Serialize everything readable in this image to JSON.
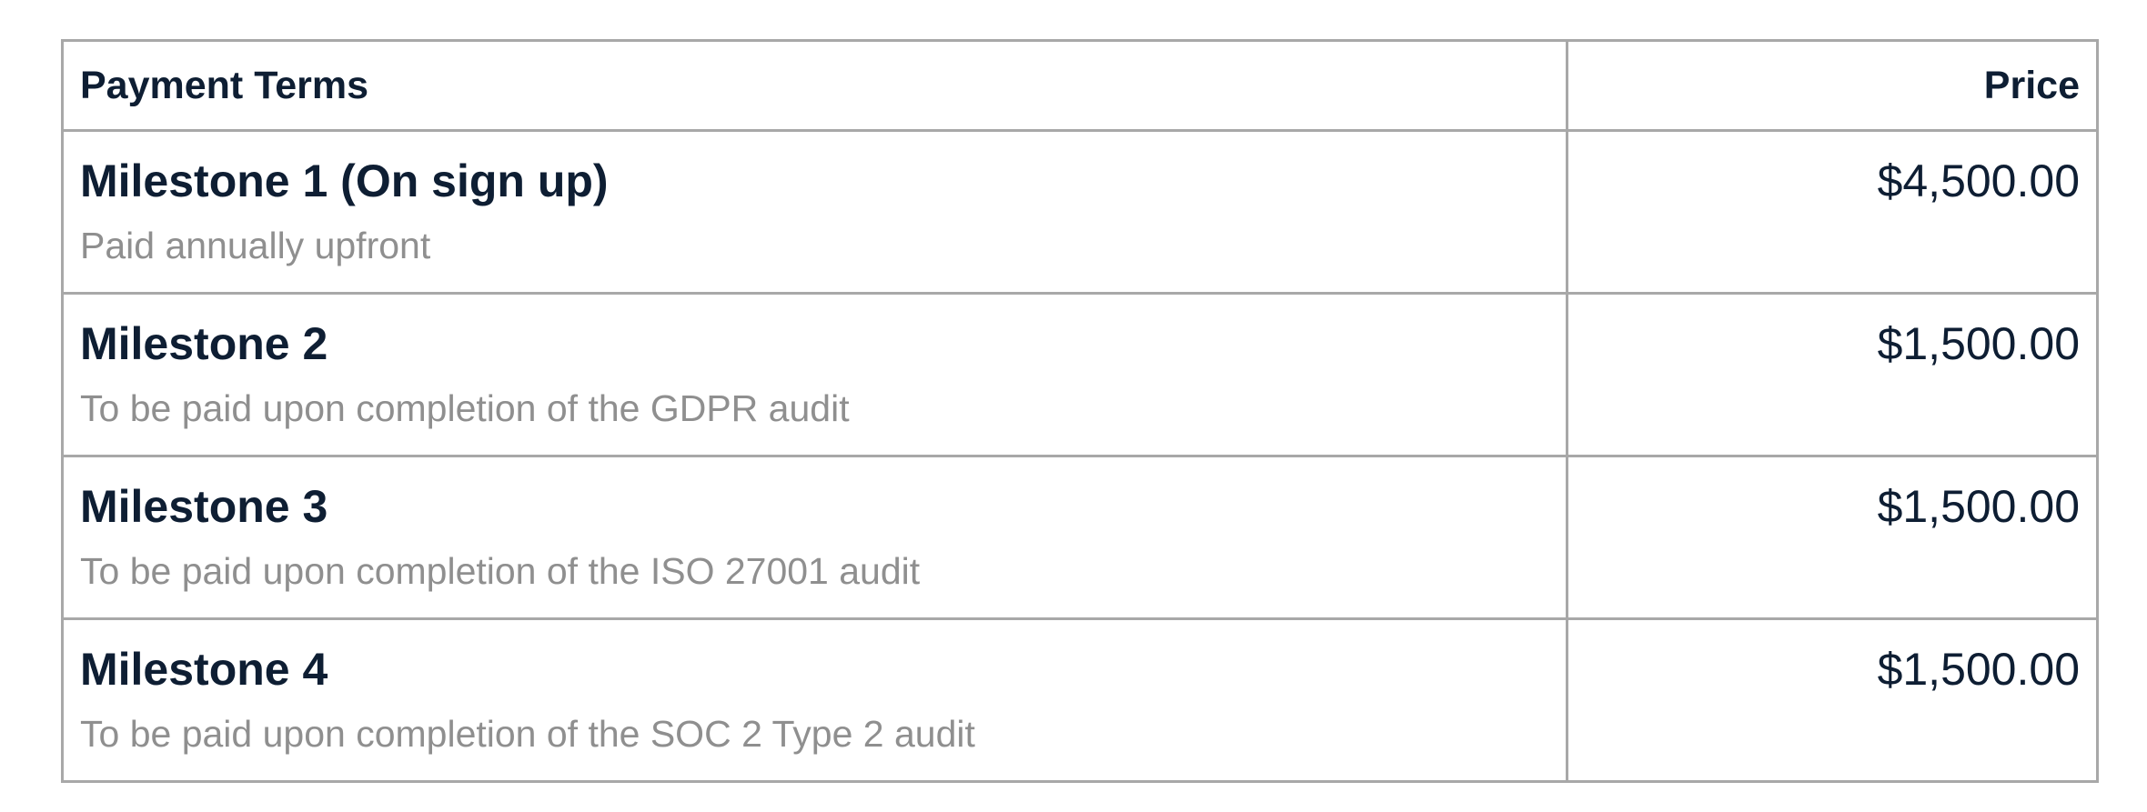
{
  "table": {
    "headers": {
      "terms": "Payment Terms",
      "price": "Price"
    },
    "rows": [
      {
        "title": "Milestone 1 (On sign up)",
        "description": "Paid annually upfront",
        "price": "$4,500.00"
      },
      {
        "title": "Milestone 2",
        "description": "To be paid upon completion of the GDPR audit",
        "price": "$1,500.00"
      },
      {
        "title": "Milestone 3",
        "description": "To be paid upon completion of the ISO 27001 audit",
        "price": "$1,500.00"
      },
      {
        "title": "Milestone 4",
        "description": "To be paid upon completion of the SOC 2 Type 2 audit",
        "price": "$1,500.00"
      }
    ]
  },
  "colors": {
    "heading_text": "#0e1e33",
    "description_text": "#8f8f8f",
    "border": "#a8a8a8"
  }
}
